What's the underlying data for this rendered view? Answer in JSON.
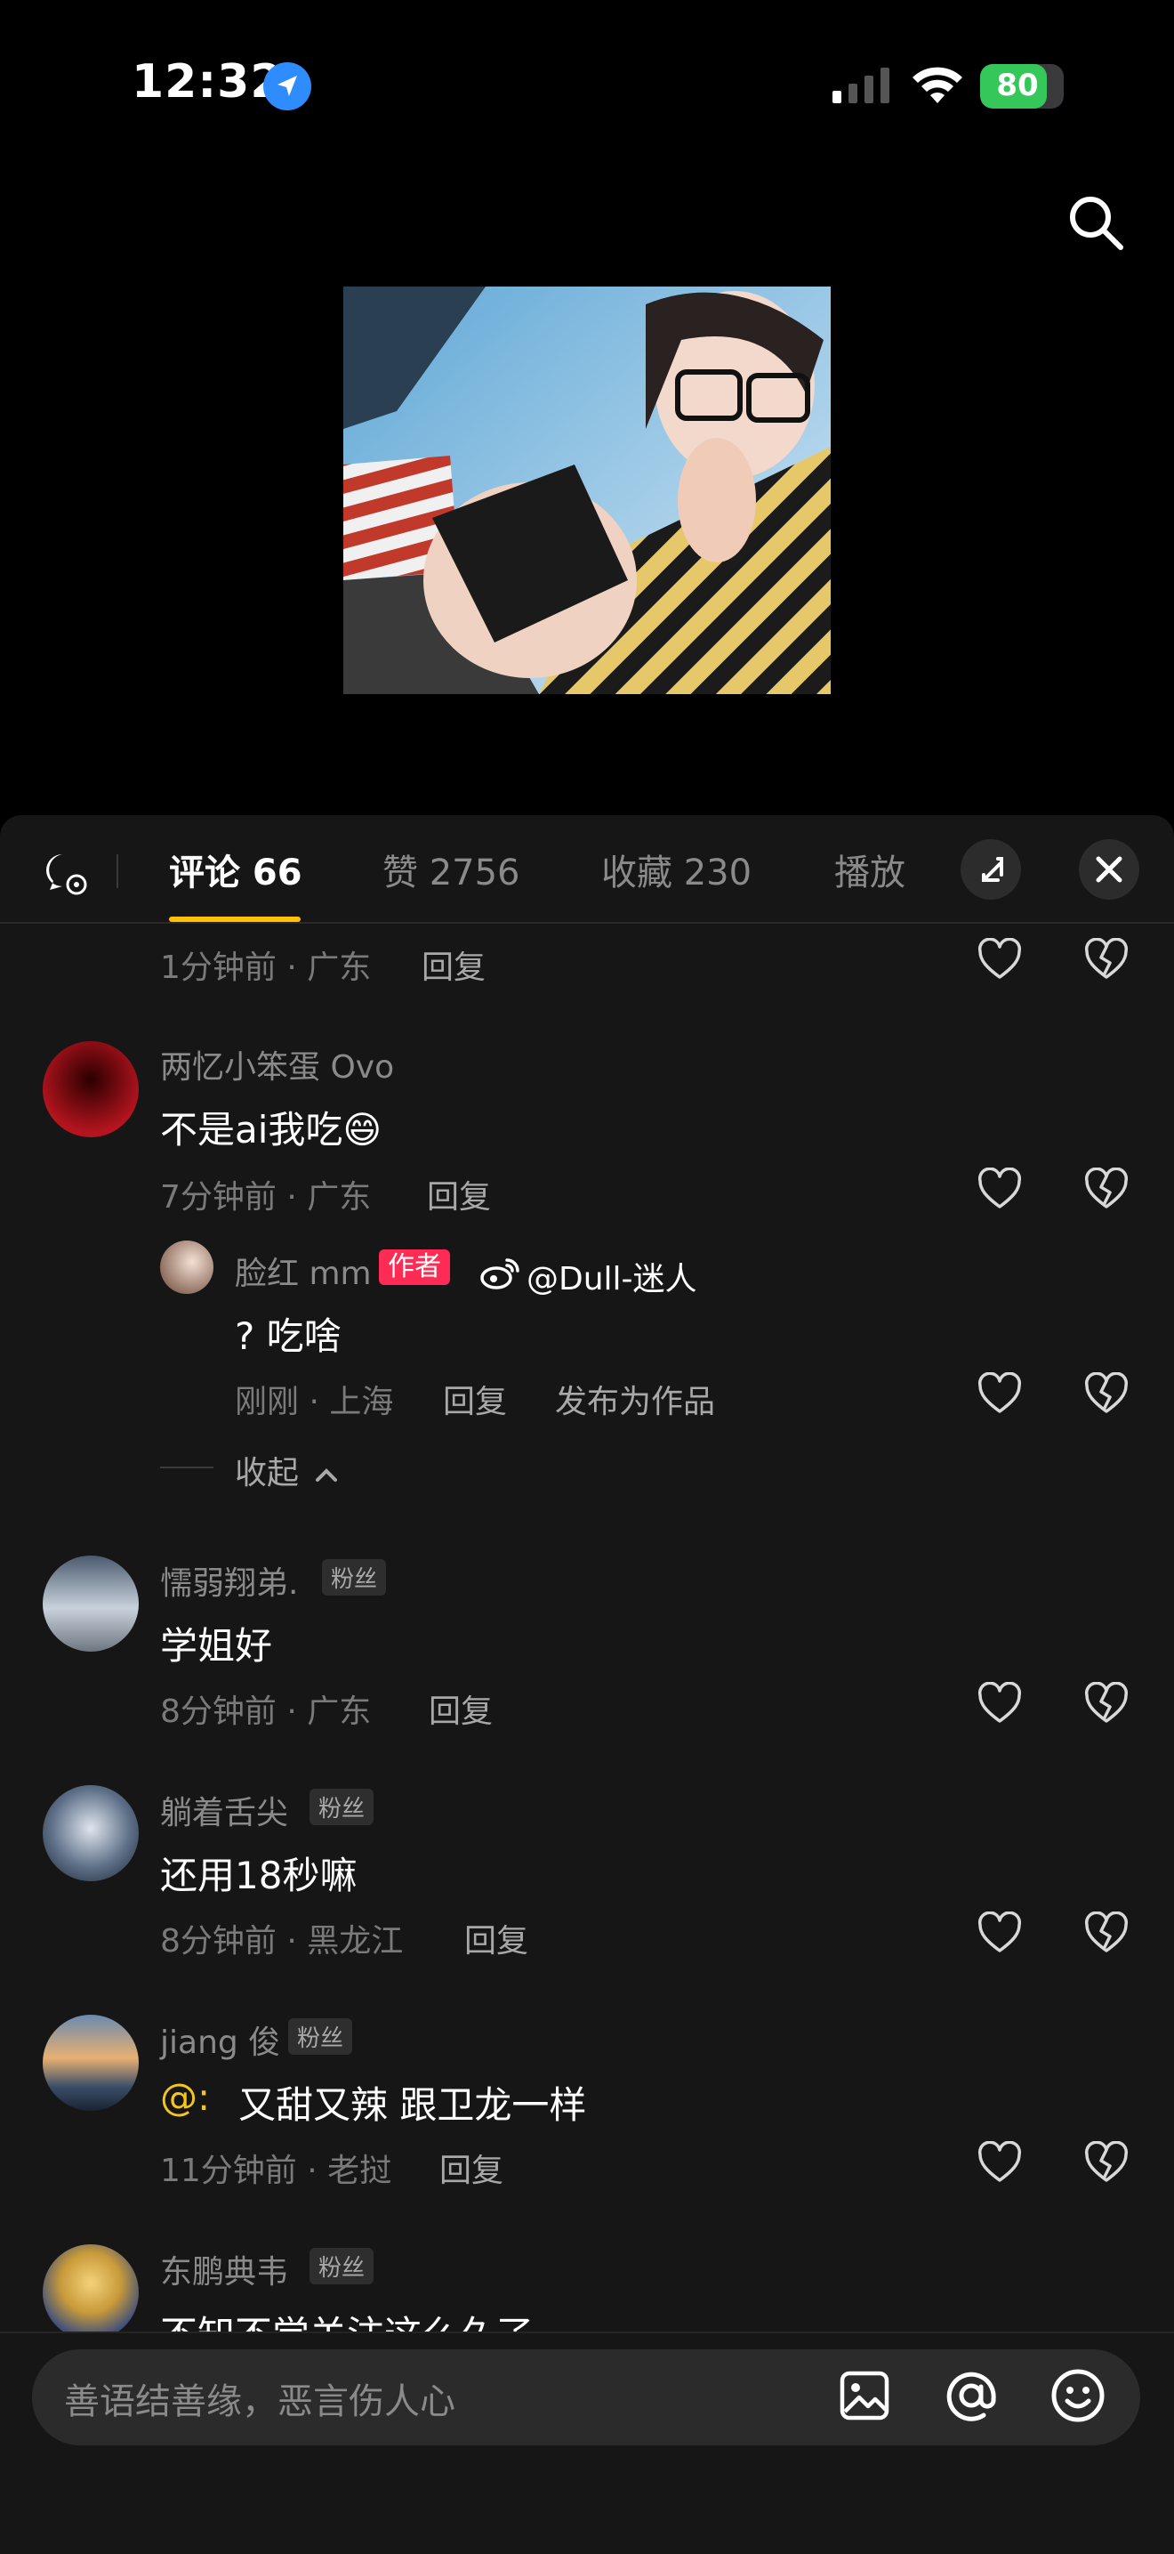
{
  "status": {
    "time": "12:32",
    "battery": "80",
    "battery_level": 0.8
  },
  "sheet": {
    "tabs": [
      {
        "label": "评论 66",
        "active": true
      },
      {
        "label": "赞 2756",
        "active": false
      },
      {
        "label": "收藏 230",
        "active": false
      },
      {
        "label": "播放",
        "active": false
      }
    ]
  },
  "comments": {
    "partial_top": {
      "meta": "1分钟前 · 广东",
      "reply": "回复"
    },
    "c1": {
      "name": "两忆小笨蛋 Ovo",
      "text": "不是ai我吃😄",
      "meta": "7分钟前 · 广东",
      "reply": "回复",
      "sub": {
        "name": "脸红 mm",
        "badge": "作者",
        "weibo": "@Dull-迷人",
        "text": "? 吃啥",
        "meta": "刚刚 · 上海",
        "reply": "回复",
        "publish": "发布为作品"
      },
      "collapse": "收起"
    },
    "c2": {
      "name": "懦弱翔弟.",
      "badge": "粉丝",
      "text": "学姐好",
      "meta": "8分钟前 · 广东",
      "reply": "回复"
    },
    "c3": {
      "name": "躺着舌尖",
      "badge": "粉丝",
      "text": "还用18秒嘛",
      "meta": "8分钟前 · 黑龙江",
      "reply": "回复"
    },
    "c4": {
      "name": "jiang 俊",
      "badge": "粉丝",
      "mention": "@:",
      "text": "又甜又辣 跟卫龙一样",
      "meta": "11分钟前 · 老挝",
      "reply": "回复"
    },
    "c5": {
      "name": "东鹏典韦",
      "badge": "粉丝",
      "text": "不知不觉关注这么久了"
    }
  },
  "input": {
    "placeholder": "善语结善缘，恶言伤人心"
  },
  "colors": {
    "accent": "#ffc107",
    "author_badge": "#fe2c55",
    "mention": "#f5c518"
  }
}
